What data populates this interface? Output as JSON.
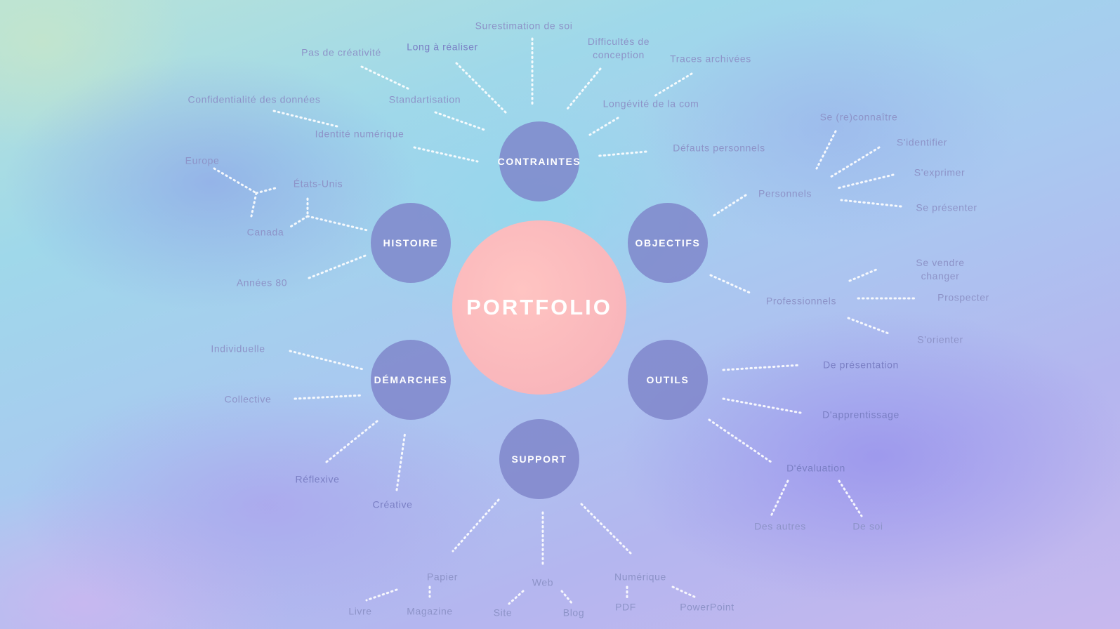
{
  "center": "PORTFOLIO",
  "hubs": {
    "contraintes": "CONTRAINTES",
    "histoire": "HISTOIRE",
    "objectifs": "OBJECTIFS",
    "demarches": "DÉMARCHES",
    "outils": "OUTILS",
    "support": "SUPPORT"
  },
  "contraintes": {
    "surestimation": "Surestimation de soi",
    "long": "Long à réaliser",
    "difficultes": "Difficultés de conception",
    "traces": "Traces archivées",
    "creativite": "Pas de créativité",
    "confidentialite": "Confidentialité des données",
    "standardisation": "Standartisation",
    "longevite": "Longévité de la com",
    "identite": "Identité numérique",
    "defauts": "Défauts personnels"
  },
  "histoire": {
    "europe": "Europe",
    "etats_unis": "États-Unis",
    "canada": "Canada",
    "annees80": "Années 80"
  },
  "objectifs": {
    "personnels": "Personnels",
    "reconnaitre": "Se (re)connaître",
    "identifier": "S'identifier",
    "exprimer": "S'exprimer",
    "presenter": "Se présenter",
    "professionnels": "Professionnels",
    "vendre": "Se vendre changer",
    "prospecter": "Prospecter",
    "orienter": "S'orienter"
  },
  "demarches": {
    "individuelle": "Individuelle",
    "collective": "Collective",
    "reflexive": "Réflexive",
    "creative": "Créative"
  },
  "outils": {
    "presentation": "De présentation",
    "apprentissage": "D'apprentissage",
    "evaluation": "D'évaluation",
    "autres": "Des autres",
    "soi": "De soi"
  },
  "support": {
    "papier": "Papier",
    "livre": "Livre",
    "magazine": "Magazine",
    "web": "Web",
    "site": "Site",
    "blog": "Blog",
    "numerique": "Numérique",
    "pdf": "PDF",
    "powerpoint": "PowerPoint"
  }
}
